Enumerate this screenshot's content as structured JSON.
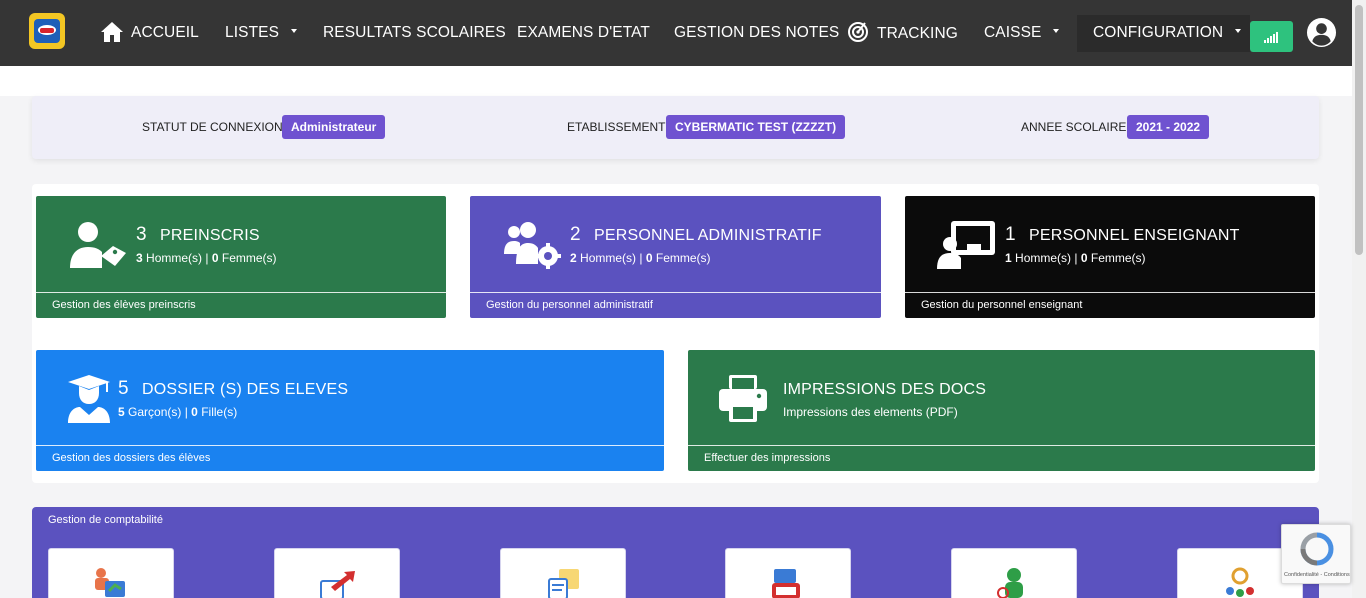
{
  "nav": {
    "home": "ACCUEIL",
    "lists": "LISTES",
    "results": "RESULTATS SCOLAIRES",
    "exams": "EXAMENS D'ETAT",
    "grades": "GESTION DES NOTES",
    "tracking": "TRACKING",
    "cashier": "CAISSE",
    "config": "CONFIGURATION"
  },
  "status": {
    "connection_label": "STATUT DE CONNEXION :",
    "connection_value": "Administrateur",
    "school_label": "ETABLISSEMENT :",
    "school_value": "CYBERMATIC TEST (ZZZZT)",
    "year_label": "ANNEE SCOLAIRE :",
    "year_value": "2021 - 2022"
  },
  "cards": {
    "preinscrits": {
      "count": "3",
      "title": "PREINSCRIS",
      "men": "3",
      "men_label": "Homme(s) |",
      "women": "0",
      "women_label": "Femme(s)",
      "footer": "Gestion des élèves preinscris",
      "color": "#2b7a4b"
    },
    "admin_staff": {
      "count": "2",
      "title": "PERSONNEL ADMINISTRATIF",
      "men": "2",
      "men_label": "Homme(s) |",
      "women": "0",
      "women_label": "Femme(s)",
      "footer": "Gestion du personnel administratif",
      "color": "#5b52bf"
    },
    "teachers": {
      "count": "1",
      "title": "PERSONNEL ENSEIGNANT",
      "men": "1",
      "men_label": "Homme(s) |",
      "women": "0",
      "women_label": "Femme(s)",
      "footer": "Gestion du personnel enseignant",
      "color": "#0b0b0b"
    },
    "students": {
      "count": "5",
      "title": "DOSSIER (S) DES ELEVES",
      "boys": "5",
      "boys_label": "Garçon(s) |",
      "girls": "0",
      "girls_label": "Fille(s)",
      "footer": "Gestion des dossiers des élèves",
      "color": "#1a82f0"
    },
    "prints": {
      "title": "IMPRESSIONS DES DOCS",
      "subtitle": "Impressions des elements (PDF)",
      "footer": "Effectuer des impressions",
      "color": "#2b7a4b"
    }
  },
  "accounting": {
    "title": "Gestion de comptabilité",
    "tiles": [
      "payment-icon",
      "transfer-icon",
      "expenses-icon",
      "cash-register-icon",
      "finance-user-icon",
      "settings-group-icon"
    ]
  },
  "recaptcha": {
    "text": "Confidentialité - Conditions"
  }
}
